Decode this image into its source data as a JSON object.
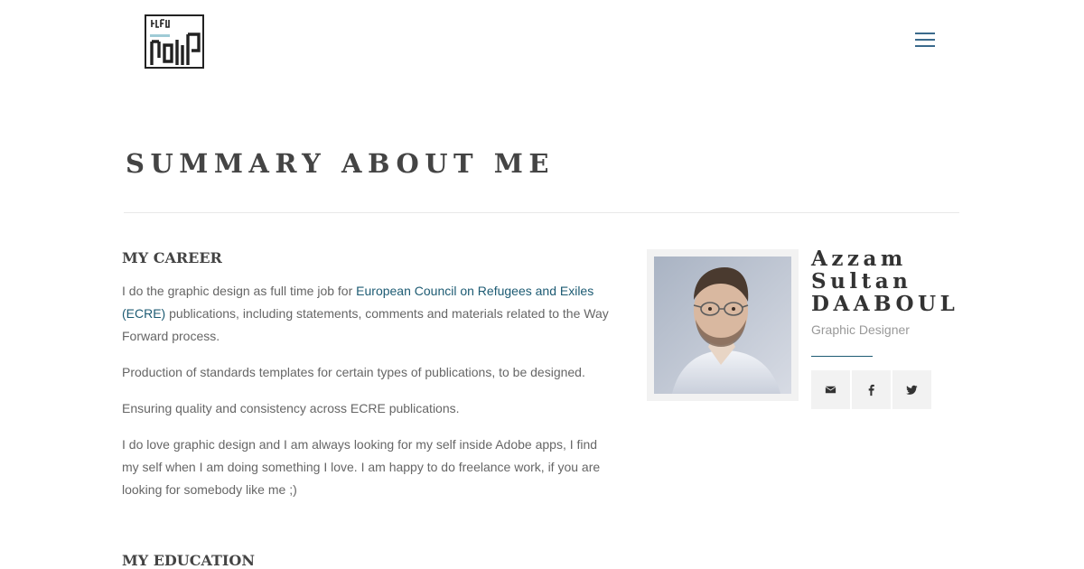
{
  "header": {
    "logo_icon": "ltf-monogram-logo",
    "menu_icon": "hamburger-menu-icon",
    "menu_color": "#3b6a8c"
  },
  "page": {
    "title": "SUMMARY ABOUT ME"
  },
  "career": {
    "heading": "MY CAREER",
    "p1_before": "I do the graphic design as full time job for ",
    "p1_link": "European Council on Refugees and Exiles (ECRE)",
    "p1_after": " publications, including statements, comments and materials related to the Way Forward process.",
    "p2": "Production of standards templates for certain types of publications, to be designed.",
    "p3": "Ensuring quality and consistency across ECRE publications.",
    "p4": "I do love graphic design and I am always looking for my self inside Adobe apps, I find my self when I am doing something I love. I am happy to do freelance work, if you are looking for somebody like me ;)",
    "link_color": "#1d5b73"
  },
  "education": {
    "heading": "MY EDUCATION"
  },
  "profile": {
    "name": "Azzam Sultan DAABOUL",
    "role": "Graphic Designer",
    "divider_color": "#1d5b73",
    "social": [
      {
        "icon": "mail-icon"
      },
      {
        "icon": "facebook-icon"
      },
      {
        "icon": "twitter-icon"
      }
    ]
  }
}
